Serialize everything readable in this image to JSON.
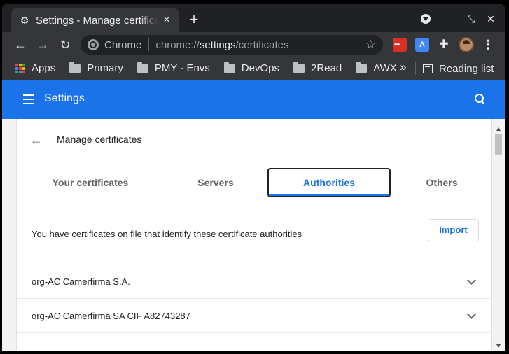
{
  "tab": {
    "title": "Settings - Manage certificates",
    "icon": "gear-icon"
  },
  "toolbar": {
    "omnibox_label": "Chrome",
    "url_prefix": "chrome://",
    "url_host": "settings",
    "url_path": "/certificates"
  },
  "bookmarks": {
    "items": [
      "Apps",
      "Primary",
      "PMY - Envs",
      "DevOps",
      "2Read",
      "AWX"
    ],
    "overflow": "»",
    "reading_list": "Reading list"
  },
  "settings": {
    "title": "Settings"
  },
  "certs": {
    "title": "Manage certificates",
    "tabs": [
      "Your certificates",
      "Servers",
      "Authorities",
      "Others"
    ],
    "active_tab": "Authorities",
    "info_text": "You have certificates on file that identify these certificate authorities",
    "import_label": "Import",
    "authorities": [
      "org-AC Camerfirma S.A.",
      "org-AC Camerfirma SA CIF A82743287"
    ]
  },
  "colors": {
    "accent": "#1a73e8",
    "chrome_frame": "#35363a",
    "tabstrip": "#202124"
  }
}
